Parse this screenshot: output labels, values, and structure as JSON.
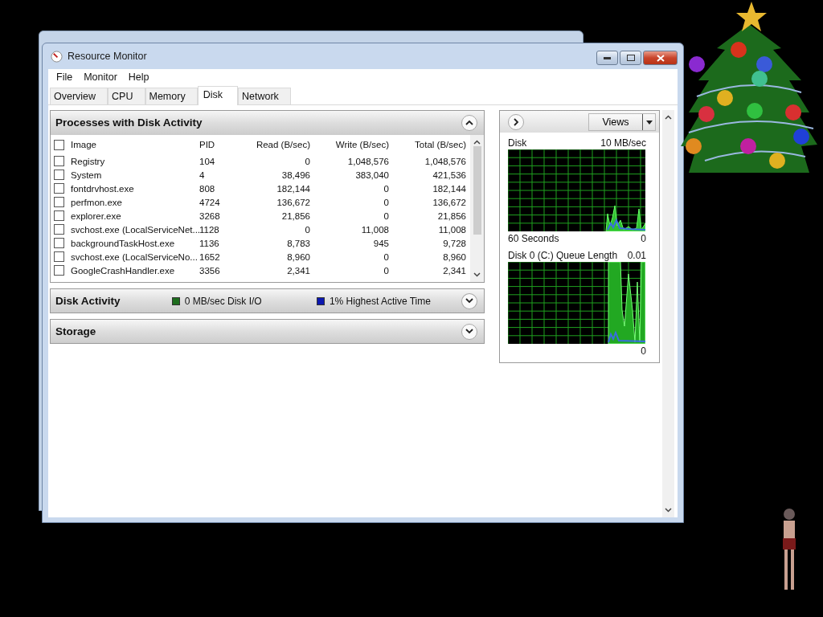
{
  "window": {
    "title": "Resource Monitor"
  },
  "menu": [
    "File",
    "Monitor",
    "Help"
  ],
  "tabs": [
    {
      "label": "Overview",
      "selected": false
    },
    {
      "label": "CPU",
      "selected": false
    },
    {
      "label": "Memory",
      "selected": false
    },
    {
      "label": "Disk",
      "selected": true
    },
    {
      "label": "Network",
      "selected": false
    }
  ],
  "processes": {
    "title": "Processes with Disk Activity",
    "expanded": true,
    "all_checked": false,
    "columns": [
      "Image",
      "PID",
      "Read (B/sec)",
      "Write (B/sec)",
      "Total (B/sec)"
    ],
    "rows": [
      {
        "checked": false,
        "cells": [
          "Registry",
          "104",
          "0",
          "1,048,576",
          "1,048,576"
        ]
      },
      {
        "checked": false,
        "cells": [
          "System",
          "4",
          "38,496",
          "383,040",
          "421,536"
        ]
      },
      {
        "checked": false,
        "cells": [
          "fontdrvhost.exe",
          "808",
          "182,144",
          "0",
          "182,144"
        ]
      },
      {
        "checked": false,
        "cells": [
          "perfmon.exe",
          "4724",
          "136,672",
          "0",
          "136,672"
        ]
      },
      {
        "checked": false,
        "cells": [
          "explorer.exe",
          "3268",
          "21,856",
          "0",
          "21,856"
        ]
      },
      {
        "checked": false,
        "cells": [
          "svchost.exe (LocalServiceNet...",
          "1128",
          "0",
          "11,008",
          "11,008"
        ]
      },
      {
        "checked": false,
        "cells": [
          "backgroundTaskHost.exe",
          "1136",
          "8,783",
          "945",
          "9,728"
        ]
      },
      {
        "checked": false,
        "cells": [
          "svchost.exe (LocalServiceNo...",
          "1652",
          "8,960",
          "0",
          "8,960"
        ]
      },
      {
        "checked": false,
        "cells": [
          "GoogleCrashHandler.exe",
          "3356",
          "2,341",
          "0",
          "2,341"
        ]
      }
    ]
  },
  "sections": [
    {
      "title": "Disk Activity",
      "expanded": false,
      "legend": [
        {
          "text": "0 MB/sec Disk I/O",
          "color": "#1e6e1e"
        },
        {
          "text": "1% Highest Active Time",
          "color": "#0c18b0"
        }
      ]
    },
    {
      "title": "Storage",
      "expanded": false
    }
  ],
  "views_button": "Views",
  "graphs": [
    {
      "title": "Disk",
      "max": "10 MB/sec",
      "footer": "60 Seconds",
      "min": "0"
    },
    {
      "title": "Disk 0 (C:) Queue Length",
      "max": "0.01",
      "min": "0"
    }
  ]
}
